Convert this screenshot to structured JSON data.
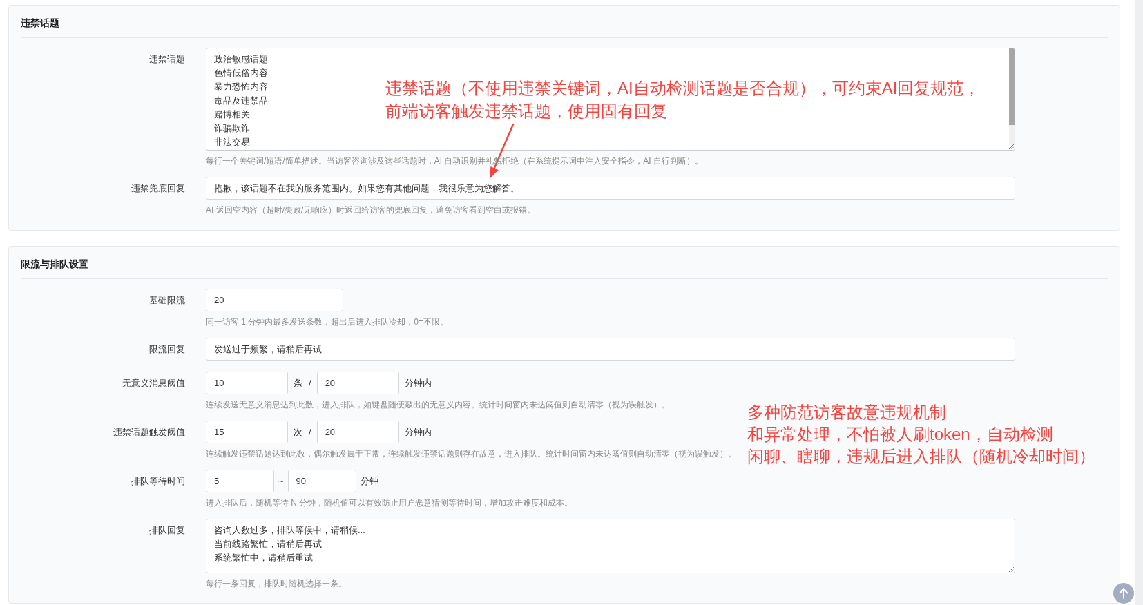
{
  "sections": [
    {
      "title": "违禁话题",
      "fields": [
        {
          "kind": "textarea",
          "label": "违禁话题",
          "scrollable": true,
          "lines": [
            "政治敏感话题",
            "色情低俗内容",
            "暴力恐怖内容",
            "毒品及违禁品",
            "赌博相关",
            "诈骗欺诈",
            "非法交易"
          ],
          "help": "每行一个关键词/短语/简单描述。当访客咨询涉及这些话题时，AI 自动识别并礼貌拒绝（在系统提示词中注入安全指令，AI 自行判断）。"
        },
        {
          "kind": "text",
          "label": "违禁兜底回复",
          "value": "抱歉，该话题不在我的服务范围内。如果您有其他问题，我很乐意为您解答。",
          "help": "AI 返回空内容（超时/失败/无响应）时返回给访客的兜底回复，避免访客看到空白或报错。"
        }
      ]
    },
    {
      "title": "限流与排队设置",
      "fields": [
        {
          "kind": "number",
          "label": "基础限流",
          "value": "20",
          "help": "同一访客 1 分钟内最多发送条数，超出后进入排队冷却，0=不限。"
        },
        {
          "kind": "text",
          "label": "限流回复",
          "value": "发送过于频繁，请稍后再试"
        },
        {
          "kind": "ratio",
          "label": "无意义消息阈值",
          "parts": [
            {
              "kind": "input",
              "value": "10"
            },
            {
              "kind": "text",
              "text": "条"
            },
            {
              "kind": "text",
              "text": "/"
            },
            {
              "kind": "input",
              "value": "20"
            },
            {
              "kind": "text",
              "text": "分钟内"
            }
          ],
          "help": "连续发送无意义消息达到此数，进入排队，如键盘随便敲出的无意义内容。统计时间窗内未达阈值则自动清零（视为误触发）。"
        },
        {
          "kind": "ratio",
          "label": "违禁话题触发阈值",
          "parts": [
            {
              "kind": "input",
              "value": "15"
            },
            {
              "kind": "text",
              "text": "次"
            },
            {
              "kind": "text",
              "text": "/"
            },
            {
              "kind": "input",
              "value": "20"
            },
            {
              "kind": "text",
              "text": "分钟内"
            }
          ],
          "help": "连续触发违禁话题达到此数，偶尔触发属于正常，连续触发违禁话题则存在故意，进入排队。统计时间窗内未达阈值则自动清零（视为误触发）。"
        },
        {
          "kind": "range",
          "label": "排队等待时间",
          "parts": [
            {
              "kind": "input",
              "value": "5"
            },
            {
              "kind": "text",
              "text": "~"
            },
            {
              "kind": "input",
              "value": "90"
            },
            {
              "kind": "text",
              "text": "分钟"
            }
          ],
          "help": "进入排队后，随机等待 N 分钟，随机值可以有效防止用户恶意猜测等待时间，增加攻击难度和成本。"
        },
        {
          "kind": "textarea",
          "label": "排队回复",
          "scrollable": false,
          "lines": [
            "咨询人数过多，排队等候中，请稍候...",
            "当前线路繁忙，请稍后再试",
            "系统繁忙中，请稍后重试"
          ],
          "help": "每行一条回复，排队时随机选择一条。"
        }
      ]
    }
  ],
  "annotations": [
    {
      "kind": "text",
      "lines": [
        "违禁话题（不使用违禁关键词，AI自动检测话题是否合规），可约束AI回复规范，",
        "前端访客触发违禁话题，使用固有回复"
      ]
    },
    {
      "kind": "arrow"
    },
    {
      "kind": "text",
      "lines": [
        "多种防范访客故意违规机制",
        "和异常处理，不怕被人刷token，自动检测",
        "闲聊、瞎聊，违规后进入排队（随机冷却时间）"
      ]
    }
  ]
}
